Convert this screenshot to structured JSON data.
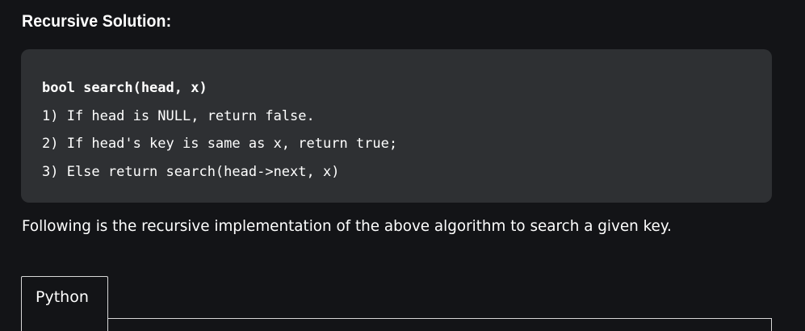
{
  "section": {
    "title": "Recursive Solution:"
  },
  "code_block": {
    "lines": [
      "bool search(head, x)",
      "1) If head is NULL, return false.",
      "2) If head's key is same as x, return true;",
      "3) Else return search(head->next, x)"
    ]
  },
  "description": "Following is the recursive implementation of the above algorithm to search a given key.",
  "tabs": [
    {
      "label": "Python",
      "active": true
    }
  ],
  "colors": {
    "page_background": "#131417",
    "code_background": "#2e3033",
    "text": "#ffffff",
    "tab_border": "#d8d8d8"
  }
}
